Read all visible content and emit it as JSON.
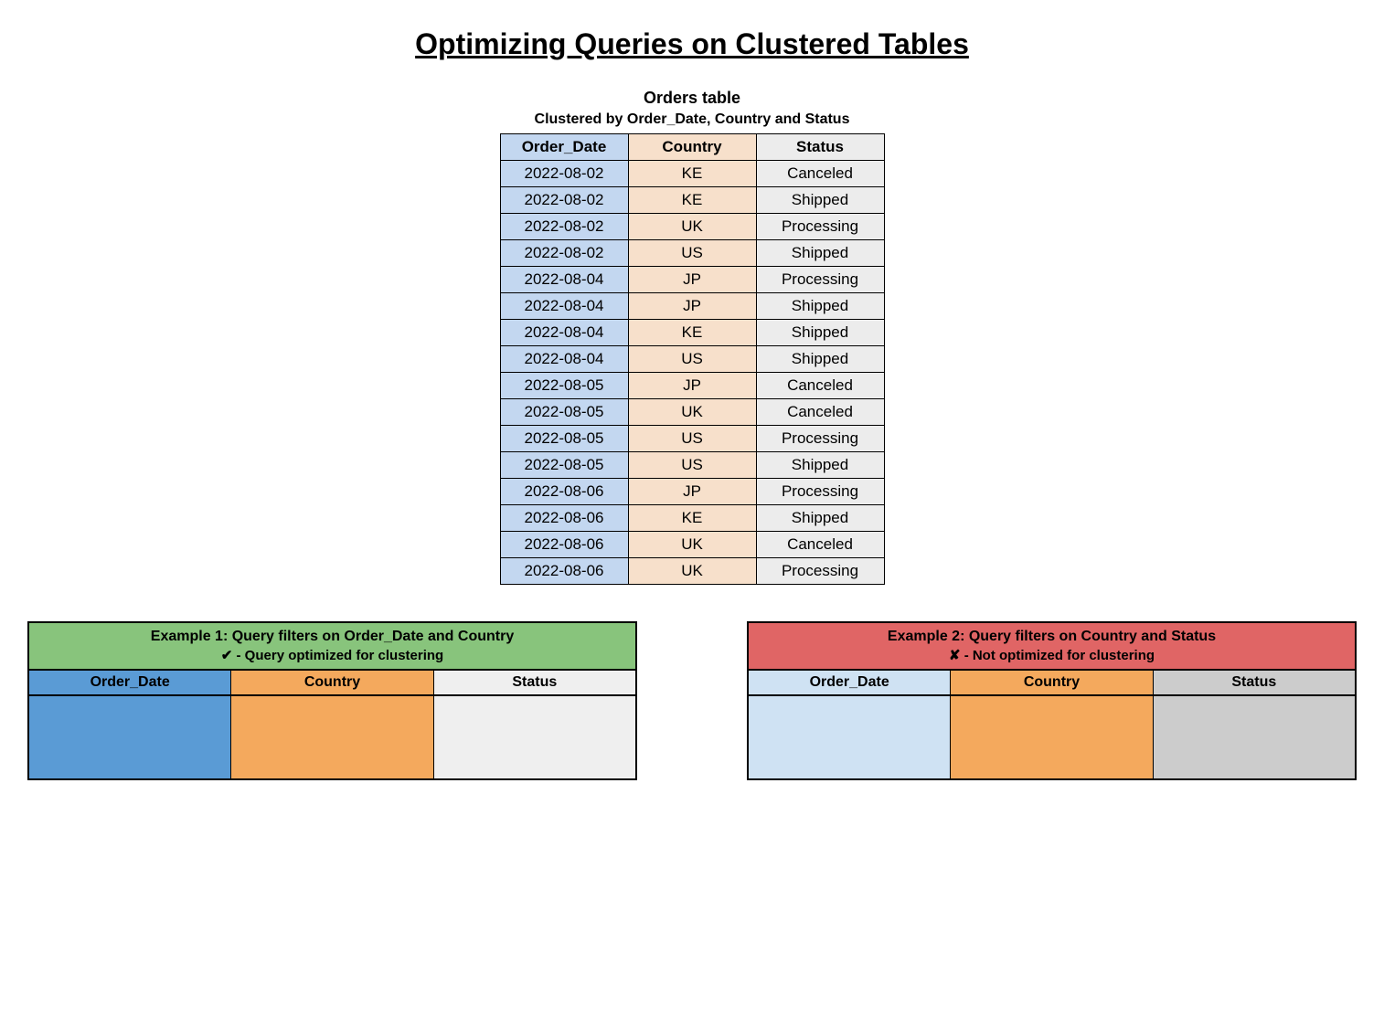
{
  "title": "Optimizing Queries on Clustered Tables",
  "orders": {
    "title": "Orders table",
    "subtitle": "Clustered by Order_Date, Country and Status",
    "headers": {
      "date": "Order_Date",
      "country": "Country",
      "status": "Status"
    },
    "rows": [
      {
        "date": "2022-08-02",
        "country": "KE",
        "status": "Canceled",
        "group_start": true
      },
      {
        "date": "2022-08-02",
        "country": "KE",
        "status": "Shipped",
        "group_start": false
      },
      {
        "date": "2022-08-02",
        "country": "UK",
        "status": "Processing",
        "group_start": false
      },
      {
        "date": "2022-08-02",
        "country": "US",
        "status": "Shipped",
        "group_start": false
      },
      {
        "date": "2022-08-04",
        "country": "JP",
        "status": "Processing",
        "group_start": true
      },
      {
        "date": "2022-08-04",
        "country": "JP",
        "status": "Shipped",
        "group_start": false
      },
      {
        "date": "2022-08-04",
        "country": "KE",
        "status": "Shipped",
        "group_start": false
      },
      {
        "date": "2022-08-04",
        "country": "US",
        "status": "Shipped",
        "group_start": false
      },
      {
        "date": "2022-08-05",
        "country": "JP",
        "status": "Canceled",
        "group_start": true
      },
      {
        "date": "2022-08-05",
        "country": "UK",
        "status": "Canceled",
        "group_start": false
      },
      {
        "date": "2022-08-05",
        "country": "US",
        "status": "Processing",
        "group_start": false
      },
      {
        "date": "2022-08-05",
        "country": "US",
        "status": "Shipped",
        "group_start": false
      },
      {
        "date": "2022-08-06",
        "country": "JP",
        "status": "Processing",
        "group_start": true
      },
      {
        "date": "2022-08-06",
        "country": "KE",
        "status": "Shipped",
        "group_start": false
      },
      {
        "date": "2022-08-06",
        "country": "UK",
        "status": "Canceled",
        "group_start": false
      },
      {
        "date": "2022-08-06",
        "country": "UK",
        "status": "Processing",
        "group_start": false
      }
    ]
  },
  "example1": {
    "title": "Example 1: Query filters on Order_Date and Country",
    "subtitle": "✔ - Query optimized for clustering",
    "headers": {
      "date": "Order_Date",
      "country": "Country",
      "status": "Status"
    }
  },
  "example2": {
    "title": "Example 2: Query filters on Country and Status",
    "subtitle": "✘ - Not optimized for clustering",
    "headers": {
      "date": "Order_Date",
      "country": "Country",
      "status": "Status"
    }
  }
}
